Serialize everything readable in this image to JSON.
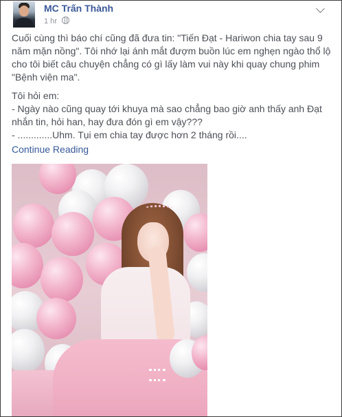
{
  "post": {
    "author": "MC Trấn Thành",
    "time": "1 hr",
    "paragraph1": "Cuối cùng thì báo chí cũng đã đưa tin: \"Tiến Đạt - Hariwon chia tay sau 9 năm mặn nồng\". Tôi nhớ lại ánh mắt đượm buồn lúc em nghẹn ngào thổ lộ cho tôi biết câu chuyện chẳng có gì lấy làm vui này khi quay chung phim \"Bệnh viện ma\".",
    "line_ask": "Tôi hỏi em:",
    "line_q": "- Ngày nào cũng quay tới khuya mà sao chẳng bao giờ anh thấy anh Đạt nhắn tin, hỏi han, hay đưa đón gì em vậy???",
    "line_a": "- .............Uhm. Tụi em chia tay được hơn 2 tháng rồi....",
    "continue_label": "Continue Reading"
  },
  "icons": {
    "privacy": "globe-icon",
    "menu": "chevron-down-icon"
  },
  "colors": {
    "link": "#365899",
    "name": "#3b5998",
    "text": "#4b4f56",
    "meta": "#90949c"
  }
}
